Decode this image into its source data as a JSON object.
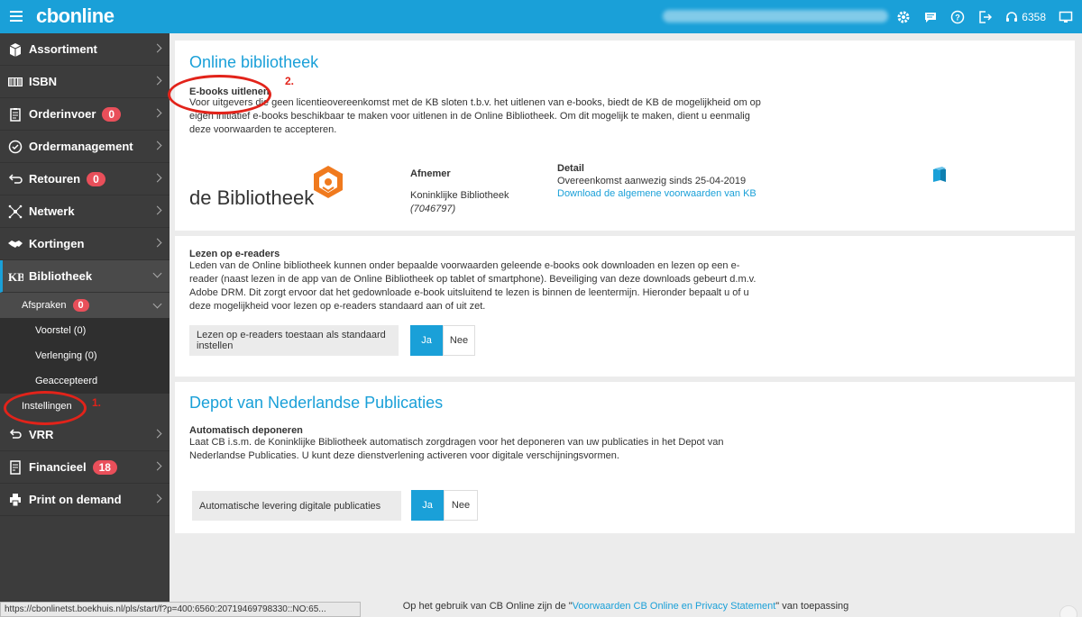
{
  "topbar": {
    "logo": "cbonline",
    "user_info": "77XXXX · Mirage Boks · boekhuis-test@nl.com",
    "count": "6358"
  },
  "sidebar": {
    "items": [
      {
        "label": "Assortiment",
        "badge": ""
      },
      {
        "label": "ISBN",
        "badge": ""
      },
      {
        "label": "Orderinvoer",
        "badge": "0"
      },
      {
        "label": "Ordermanagement",
        "badge": ""
      },
      {
        "label": "Retouren",
        "badge": "0"
      },
      {
        "label": "Netwerk",
        "badge": ""
      },
      {
        "label": "Kortingen",
        "badge": ""
      },
      {
        "label": "Bibliotheek",
        "badge": ""
      }
    ],
    "afspraken": {
      "label": "Afspraken",
      "badge": "0"
    },
    "sub_items": [
      "Voorstel (0)",
      "Verlenging (0)",
      "Geaccepteerd"
    ],
    "instellingen": "Instellingen",
    "items_after": [
      {
        "label": "VRR",
        "badge": ""
      },
      {
        "label": "Financieel",
        "badge": "18"
      },
      {
        "label": "Print on demand",
        "badge": ""
      }
    ]
  },
  "online_bib": {
    "title": "Online bibliotheek",
    "subtitle": "E-books uitlenen",
    "text": "Voor uitgevers die geen licentieovereenkomst met de KB sloten t.b.v. het uitlenen van e-books, biedt de KB de mogelijkheid om op eigen initiatief e-books beschikbaar te maken voor uitlenen in de Online Bibliotheek. Om dit mogelijk te maken, dient u eenmalig deze voorwaarden te accepteren.",
    "logo_text": "de Bibliotheek",
    "afnemer_label": "Afnemer",
    "afnemer_name": "Koninklijke Bibliotheek",
    "afnemer_id": "(7046797)",
    "detail_label": "Detail",
    "detail_text": "Overeenkomst aanwezig sinds 25-04-2019",
    "detail_link": "Download de algemene voorwaarden van KB"
  },
  "ereaders": {
    "subtitle": "Lezen op e-readers",
    "text": "Leden van de Online bibliotheek kunnen onder bepaalde voorwaarden geleende e-books ook downloaden en lezen op een e-reader (naast lezen in de app van de Online Bibliotheek op tablet of smartphone). Beveiliging van deze downloads gebeurt d.m.v. Adobe DRM. Dit zorgt ervoor dat het gedownloade e-book uitsluitend te lezen is binnen de leentermijn. Hieronder bepaalt u of u deze mogelijkheid voor lezen op e-readers standaard aan of uit zet.",
    "setting_label": "Lezen op e-readers toestaan als standaard instellen",
    "yes": "Ja",
    "no": "Nee"
  },
  "depot": {
    "title": "Depot van Nederlandse Publicaties",
    "subtitle": "Automatisch deponeren",
    "text": "Laat CB i.s.m. de Koninklijke Bibliotheek automatisch zorgdragen voor het deponeren van uw publicaties in het Depot van Nederlandse Publicaties. U kunt deze dienstverlening activeren voor digitale verschijningsvormen.",
    "setting_label": "Automatische levering digitale publicaties",
    "yes": "Ja",
    "no": "Nee"
  },
  "annotations": {
    "one": "1.",
    "two": "2."
  },
  "statusbar": "https://cbonlinetst.boekhuis.nl/pls/start/f?p=400:6560:20719469798330::NO:65...",
  "footer": {
    "before": "Op het gebruik van CB Online zijn de \"",
    "link": "Voorwaarden CB Online en Privacy Statement",
    "after": "\" van toepassing"
  },
  "colors": {
    "accent": "#1aa0d8",
    "sidebar": "#3c3c3c",
    "badge": "#e94f5a",
    "annotation": "#e2231a"
  }
}
